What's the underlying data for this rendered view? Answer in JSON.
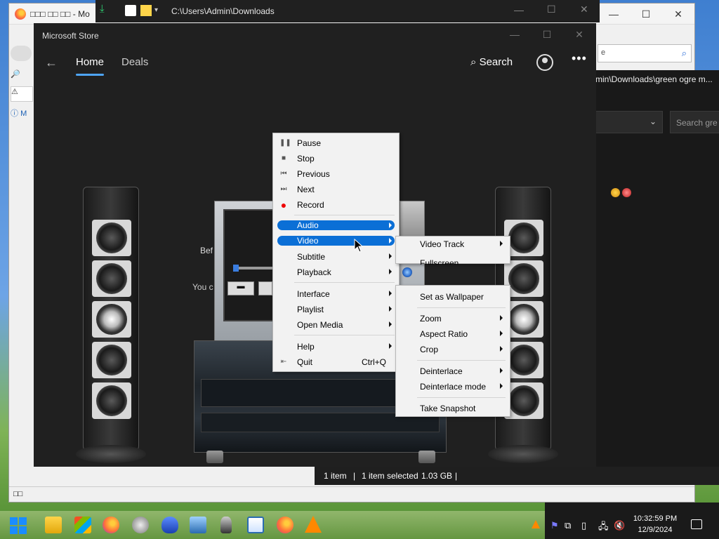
{
  "firefox": {
    "tab_title": "□□□ □□ □□ - Mo",
    "search_value": "e",
    "status_text": "□□",
    "side_label": "M"
  },
  "explorer_top": {
    "path": "C:\\Users\\Admin\\Downloads"
  },
  "explorer2": {
    "title": "min\\Downloads\\green ogre m...",
    "search_placeholder": "Search gre"
  },
  "explorer_status": {
    "items": "1 item",
    "selected": "1 item selected",
    "size": "1.03 GB",
    "sep": "|"
  },
  "store": {
    "title": "Microsoft Store",
    "tabs": [
      {
        "label": "Home",
        "active": true
      },
      {
        "label": "Deals",
        "active": false
      }
    ],
    "search_label": "Search",
    "more_label": "•••",
    "body_text_1": "Bef",
    "body_text_2": "You c"
  },
  "vlc_menu": {
    "items": [
      {
        "label": "Pause",
        "icon": "pause-icon"
      },
      {
        "label": "Stop",
        "icon": "stop-icon"
      },
      {
        "label": "Previous",
        "icon": "previous-icon"
      },
      {
        "label": "Next",
        "icon": "next-icon"
      },
      {
        "label": "Record",
        "icon": "record-icon"
      },
      {
        "label": "Audio",
        "submenu": true,
        "highlighted": true
      },
      {
        "label": "Video",
        "submenu": true,
        "highlighted": true
      },
      {
        "label": "Subtitle",
        "submenu": true
      },
      {
        "label": "Playback",
        "submenu": true
      },
      {
        "label": "Interface",
        "submenu": true
      },
      {
        "label": "Playlist",
        "submenu": true
      },
      {
        "label": "Open Media",
        "submenu": true
      },
      {
        "label": "Help",
        "submenu": true
      },
      {
        "label": "Quit",
        "shortcut": "Ctrl+Q",
        "icon": "quit-icon"
      }
    ]
  },
  "video_submenu": {
    "items": [
      {
        "label": "Video Track",
        "submenu": true
      },
      {
        "label": "Fullscreen"
      },
      {
        "label": "Set as Wallpaper"
      },
      {
        "label": "Zoom",
        "submenu": true
      },
      {
        "label": "Aspect Ratio",
        "submenu": true
      },
      {
        "label": "Crop",
        "submenu": true
      },
      {
        "label": "Deinterlace",
        "submenu": true
      },
      {
        "label": "Deinterlace mode",
        "submenu": true
      },
      {
        "label": "Take Snapshot"
      }
    ]
  },
  "taskbar": {
    "time": "10:32:59 PM",
    "date": "12/9/2024"
  },
  "colors": {
    "accent": "#0b6fd6",
    "store_bg": "#202020",
    "menu_bg": "#f2f2f2"
  }
}
